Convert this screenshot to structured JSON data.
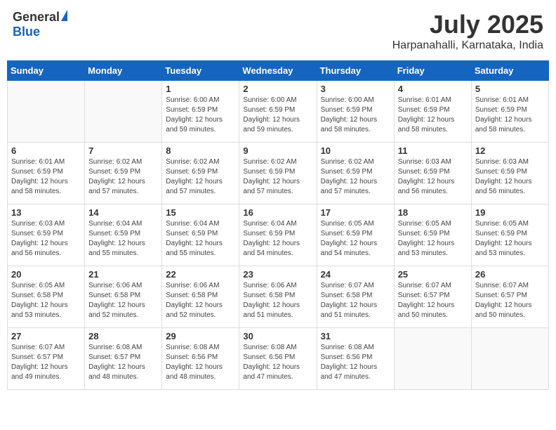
{
  "header": {
    "logo_general": "General",
    "logo_blue": "Blue",
    "month_title": "July 2025",
    "location": "Harpanahalli, Karnataka, India"
  },
  "days_of_week": [
    "Sunday",
    "Monday",
    "Tuesday",
    "Wednesday",
    "Thursday",
    "Friday",
    "Saturday"
  ],
  "weeks": [
    [
      {
        "day": "",
        "info": ""
      },
      {
        "day": "",
        "info": ""
      },
      {
        "day": "1",
        "info": "Sunrise: 6:00 AM\nSunset: 6:59 PM\nDaylight: 12 hours and 59 minutes."
      },
      {
        "day": "2",
        "info": "Sunrise: 6:00 AM\nSunset: 6:59 PM\nDaylight: 12 hours and 59 minutes."
      },
      {
        "day": "3",
        "info": "Sunrise: 6:00 AM\nSunset: 6:59 PM\nDaylight: 12 hours and 58 minutes."
      },
      {
        "day": "4",
        "info": "Sunrise: 6:01 AM\nSunset: 6:59 PM\nDaylight: 12 hours and 58 minutes."
      },
      {
        "day": "5",
        "info": "Sunrise: 6:01 AM\nSunset: 6:59 PM\nDaylight: 12 hours and 58 minutes."
      }
    ],
    [
      {
        "day": "6",
        "info": "Sunrise: 6:01 AM\nSunset: 6:59 PM\nDaylight: 12 hours and 58 minutes."
      },
      {
        "day": "7",
        "info": "Sunrise: 6:02 AM\nSunset: 6:59 PM\nDaylight: 12 hours and 57 minutes."
      },
      {
        "day": "8",
        "info": "Sunrise: 6:02 AM\nSunset: 6:59 PM\nDaylight: 12 hours and 57 minutes."
      },
      {
        "day": "9",
        "info": "Sunrise: 6:02 AM\nSunset: 6:59 PM\nDaylight: 12 hours and 57 minutes."
      },
      {
        "day": "10",
        "info": "Sunrise: 6:02 AM\nSunset: 6:59 PM\nDaylight: 12 hours and 57 minutes."
      },
      {
        "day": "11",
        "info": "Sunrise: 6:03 AM\nSunset: 6:59 PM\nDaylight: 12 hours and 56 minutes."
      },
      {
        "day": "12",
        "info": "Sunrise: 6:03 AM\nSunset: 6:59 PM\nDaylight: 12 hours and 56 minutes."
      }
    ],
    [
      {
        "day": "13",
        "info": "Sunrise: 6:03 AM\nSunset: 6:59 PM\nDaylight: 12 hours and 56 minutes."
      },
      {
        "day": "14",
        "info": "Sunrise: 6:04 AM\nSunset: 6:59 PM\nDaylight: 12 hours and 55 minutes."
      },
      {
        "day": "15",
        "info": "Sunrise: 6:04 AM\nSunset: 6:59 PM\nDaylight: 12 hours and 55 minutes."
      },
      {
        "day": "16",
        "info": "Sunrise: 6:04 AM\nSunset: 6:59 PM\nDaylight: 12 hours and 54 minutes."
      },
      {
        "day": "17",
        "info": "Sunrise: 6:05 AM\nSunset: 6:59 PM\nDaylight: 12 hours and 54 minutes."
      },
      {
        "day": "18",
        "info": "Sunrise: 6:05 AM\nSunset: 6:59 PM\nDaylight: 12 hours and 53 minutes."
      },
      {
        "day": "19",
        "info": "Sunrise: 6:05 AM\nSunset: 6:59 PM\nDaylight: 12 hours and 53 minutes."
      }
    ],
    [
      {
        "day": "20",
        "info": "Sunrise: 6:05 AM\nSunset: 6:58 PM\nDaylight: 12 hours and 53 minutes."
      },
      {
        "day": "21",
        "info": "Sunrise: 6:06 AM\nSunset: 6:58 PM\nDaylight: 12 hours and 52 minutes."
      },
      {
        "day": "22",
        "info": "Sunrise: 6:06 AM\nSunset: 6:58 PM\nDaylight: 12 hours and 52 minutes."
      },
      {
        "day": "23",
        "info": "Sunrise: 6:06 AM\nSunset: 6:58 PM\nDaylight: 12 hours and 51 minutes."
      },
      {
        "day": "24",
        "info": "Sunrise: 6:07 AM\nSunset: 6:58 PM\nDaylight: 12 hours and 51 minutes."
      },
      {
        "day": "25",
        "info": "Sunrise: 6:07 AM\nSunset: 6:57 PM\nDaylight: 12 hours and 50 minutes."
      },
      {
        "day": "26",
        "info": "Sunrise: 6:07 AM\nSunset: 6:57 PM\nDaylight: 12 hours and 50 minutes."
      }
    ],
    [
      {
        "day": "27",
        "info": "Sunrise: 6:07 AM\nSunset: 6:57 PM\nDaylight: 12 hours and 49 minutes."
      },
      {
        "day": "28",
        "info": "Sunrise: 6:08 AM\nSunset: 6:57 PM\nDaylight: 12 hours and 48 minutes."
      },
      {
        "day": "29",
        "info": "Sunrise: 6:08 AM\nSunset: 6:56 PM\nDaylight: 12 hours and 48 minutes."
      },
      {
        "day": "30",
        "info": "Sunrise: 6:08 AM\nSunset: 6:56 PM\nDaylight: 12 hours and 47 minutes."
      },
      {
        "day": "31",
        "info": "Sunrise: 6:08 AM\nSunset: 6:56 PM\nDaylight: 12 hours and 47 minutes."
      },
      {
        "day": "",
        "info": ""
      },
      {
        "day": "",
        "info": ""
      }
    ]
  ]
}
